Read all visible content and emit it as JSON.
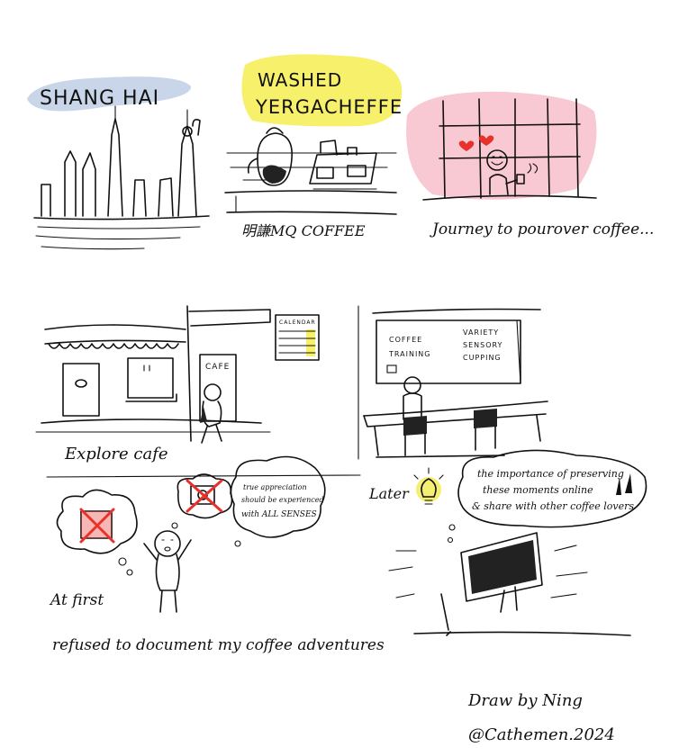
{
  "panels": {
    "shanghai": {
      "label": "SHANG HAI"
    },
    "yirgacheffe": {
      "title_line1": "WASHED",
      "title_line2": "YERGACHEFFE",
      "caption": "明謙MQ COFFEE"
    },
    "journey": {
      "caption": "Journey to pourover coffee..."
    },
    "explore": {
      "caption": "Explore cafe",
      "cafe_sign": "CAFE",
      "calendar_title": "CALENDAR"
    },
    "classroom": {
      "board_left_1": "COFFEE",
      "board_left_2": "TRAINING",
      "board_right_1": "VARIETY",
      "board_right_2": "SENSORY",
      "board_right_3": "CUPPING"
    },
    "at_first": {
      "label": "At first",
      "thought_line1": "true appreciation",
      "thought_line2": "should be experienced",
      "thought_line3": "with ALL SENSES",
      "caption": "refused to document my coffee adventures"
    },
    "later": {
      "label": "Later",
      "thought_line1": "the importance of preserving",
      "thought_line2": "these moments online",
      "thought_line3": "& share with other coffee lovers"
    }
  },
  "signature": {
    "line1": "Draw by Ning",
    "line2": "@Cathemen.2024"
  },
  "colors": {
    "yellow": "#f7f06a",
    "blue": "#c9d6ea",
    "pink": "#f8c9d2",
    "red": "#e8312b",
    "bulb": "#f4ee72"
  }
}
